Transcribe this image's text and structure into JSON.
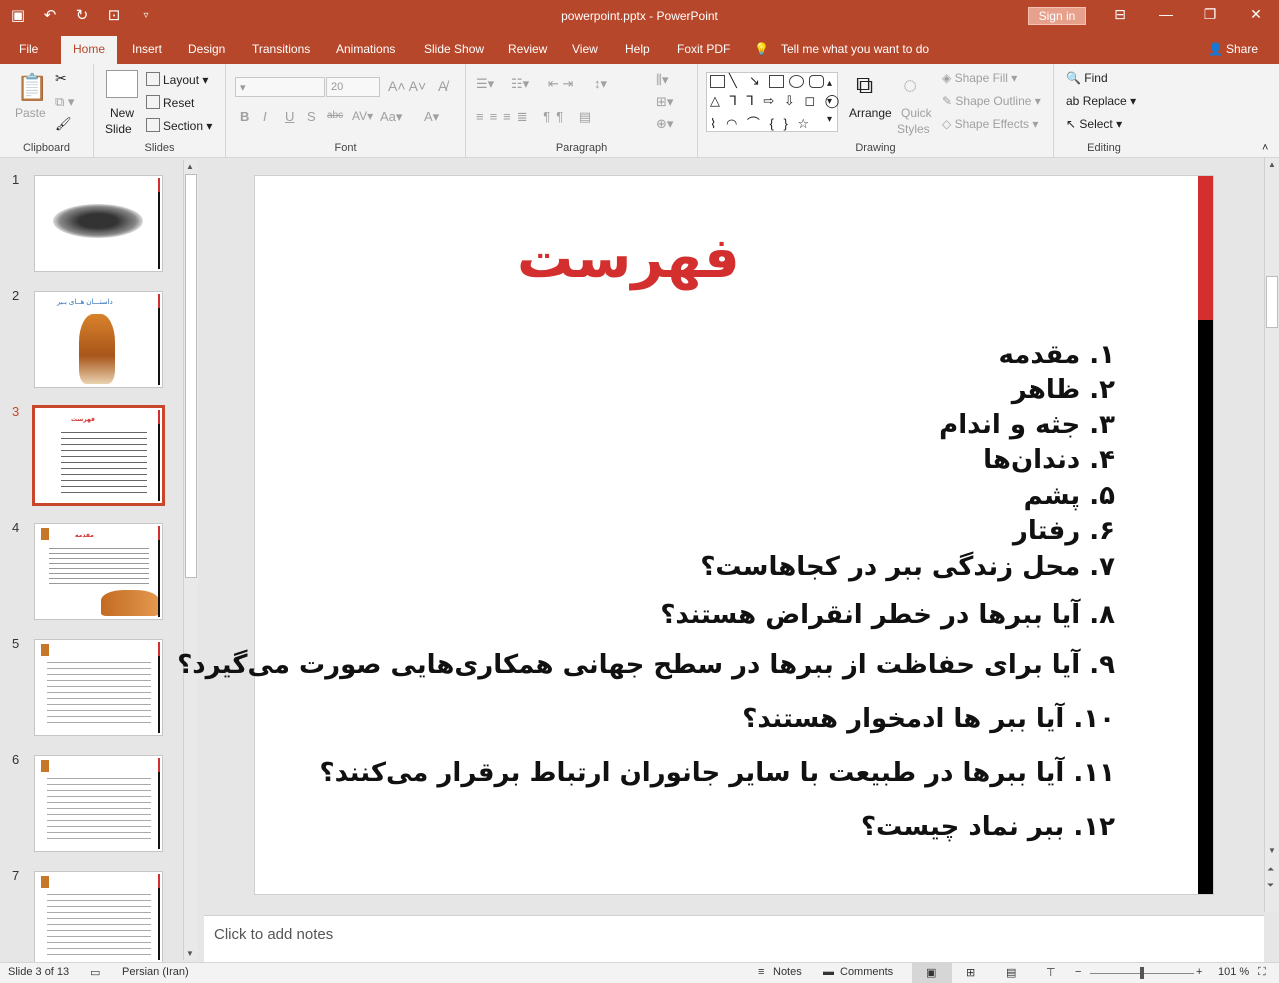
{
  "window": {
    "title": "powerpoint.pptx  -  PowerPoint",
    "signin": "Sign in"
  },
  "tabs": [
    "File",
    "Home",
    "Insert",
    "Design",
    "Transitions",
    "Animations",
    "Slide Show",
    "Review",
    "View",
    "Help",
    "Foxit PDF"
  ],
  "tellme": "Tell me what you want to do",
  "share": "Share",
  "ribbon": {
    "clipboard": {
      "label": "Clipboard",
      "paste": "Paste"
    },
    "slides": {
      "label": "Slides",
      "new_slide_1": "New",
      "new_slide_2": "Slide",
      "layout": "Layout",
      "reset": "Reset",
      "section": "Section"
    },
    "font": {
      "label": "Font",
      "size": "20"
    },
    "paragraph": {
      "label": "Paragraph"
    },
    "drawing": {
      "label": "Drawing",
      "arrange": "Arrange",
      "quick": "Quick",
      "styles": "Styles",
      "shape_fill": "Shape Fill",
      "shape_outline": "Shape Outline",
      "shape_effects": "Shape Effects"
    },
    "editing": {
      "label": "Editing",
      "find": "Find",
      "replace": "Replace",
      "select": "Select"
    }
  },
  "thumbnails": [
    "1",
    "2",
    "3",
    "4",
    "5",
    "6",
    "7"
  ],
  "thumb2_title": "داستـــان هــای بـبر",
  "thumb3_title": "فهرست",
  "thumb4_title": "مقدمه",
  "slide": {
    "title": "فهرست",
    "items": [
      "۱. مقدمه",
      "۲. ظاهر",
      "۳. جثه و اندام",
      "۴. دندان‌ها",
      "۵. پشم",
      "۶. رفتار",
      "۷. محل زندگی ببر در کجاهاست؟",
      "۸. آیا ببرها در خطر انقراض هستند؟",
      "۹. آیا برای حفاظت از ببرها در سطح جهانی همکاری‌هایی صورت می‌گیرد؟",
      "۱۰. آیا ببر ها ادمخوار هستند؟",
      "۱۱. آیا ببرها در طبیعت با سایر جانوران ارتباط برقرار می‌کنند؟",
      "۱۲. ببر نماد چیست؟"
    ]
  },
  "notes_placeholder": "Click to add notes",
  "status": {
    "slide": "Slide 3 of 13",
    "lang": "Persian (Iran)",
    "notes": "Notes",
    "comments": "Comments",
    "zoom": "101 %"
  }
}
